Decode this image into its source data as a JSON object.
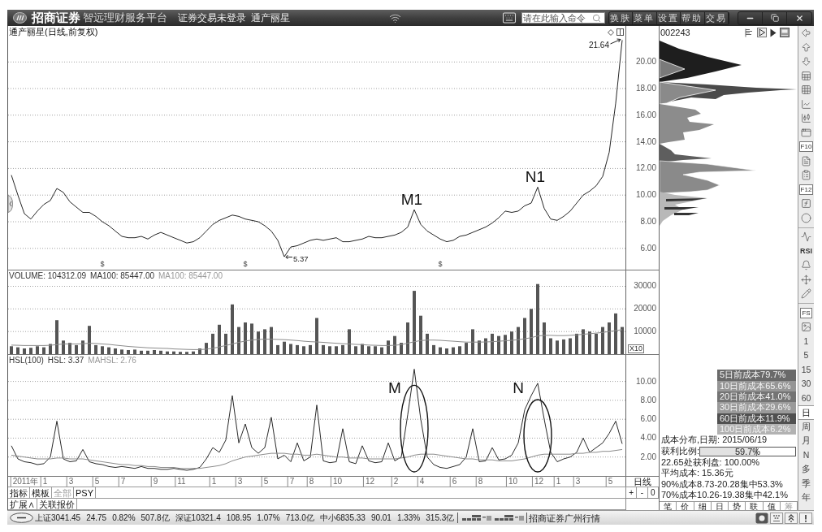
{
  "title_bar": {
    "brand": "招商证券",
    "platform": "智远理财服务平台",
    "login_status": "证券交易未登录",
    "stock_name": "通产丽星",
    "command_placeholder": "请在此输入命令",
    "menu": [
      "换肤",
      "菜单",
      "设置",
      "帮助",
      "交易"
    ]
  },
  "price_panel": {
    "chart_data": {
      "type": "line",
      "title": "通产丽星(日线,前复权)",
      "grid": true,
      "ylim": [
        4.4,
        22.7
      ],
      "yticks": [
        {
          "value": 6,
          "label": "6.00"
        },
        {
          "value": 8,
          "label": "8.00"
        },
        {
          "value": 10,
          "label": "10.00"
        },
        {
          "value": 12,
          "label": "12.00"
        },
        {
          "value": 14,
          "label": "14.00"
        },
        {
          "value": 16,
          "label": "16.00"
        },
        {
          "value": 18,
          "label": "18.00"
        },
        {
          "value": 20,
          "label": "20.00"
        }
      ],
      "values": [
        11.5,
        10.0,
        8.6,
        8.2,
        8.8,
        9.3,
        9.6,
        10.5,
        10.2,
        9.5,
        9.1,
        8.7,
        8.7,
        8.4,
        8.0,
        7.7,
        7.3,
        6.9,
        6.8,
        6.8,
        6.9,
        6.7,
        7.0,
        7.2,
        7.0,
        6.8,
        6.6,
        6.4,
        6.5,
        6.8,
        7.3,
        7.8,
        8.1,
        8.3,
        8.5,
        8.4,
        8.2,
        8.1,
        8.0,
        7.7,
        7.3,
        6.6,
        5.37,
        6.1,
        6.2,
        6.4,
        6.6,
        6.7,
        6.6,
        6.7,
        6.8,
        6.5,
        6.5,
        6.6,
        6.7,
        6.9,
        6.8,
        6.8,
        6.9,
        7.0,
        7.2,
        7.6,
        8.9,
        7.8,
        7.3,
        7.0,
        6.7,
        6.5,
        6.6,
        6.9,
        7.0,
        7.2,
        7.4,
        7.6,
        7.9,
        8.3,
        8.8,
        8.7,
        8.8,
        9.2,
        9.4,
        10.6,
        9.0,
        8.2,
        8.1,
        8.4,
        8.8,
        9.4,
        10.0,
        10.3,
        10.7,
        11.4,
        13.2,
        16.9,
        21.64
      ],
      "annotations": [
        "21.64",
        "M1",
        "N1",
        "5.37",
        "$",
        "$",
        "$"
      ]
    }
  },
  "volume_panel": {
    "legend": [
      {
        "text": "VOLUME: 104312.09",
        "color": "#333333"
      },
      {
        "text": "MA100: 85447.00",
        "color": "#333333"
      },
      {
        "text": "MA100: 85447.00",
        "color": "#999999"
      }
    ],
    "scale_label": "X10",
    "chart_data": {
      "type": "bar",
      "grid": true,
      "ylim": [
        0,
        37000
      ],
      "yticks": [
        10000,
        20000,
        30000
      ],
      "series": [
        {
          "color": "#555555",
          "values": [
            3500,
            3000,
            2500,
            2800,
            3500,
            3000,
            4500,
            15000,
            6000,
            5000,
            4000,
            6000,
            12500,
            4000,
            3500,
            3000,
            2500,
            2000,
            1800,
            2000,
            1500,
            1500,
            1800,
            1500,
            1200,
            1200,
            1000,
            1000,
            1200,
            2500,
            5000,
            9000,
            13000,
            9000,
            22000,
            12000,
            14000,
            13500,
            10000,
            11000,
            12000,
            4000,
            5500,
            4500,
            4000,
            3500,
            4000,
            16000,
            4000,
            3500,
            3500,
            4000,
            11000,
            3500,
            4500,
            3500,
            3500,
            3000,
            6000,
            8000,
            5000,
            14000,
            28000,
            17000,
            9000,
            4000,
            3000,
            2500,
            3000,
            3500,
            5000,
            11000,
            6000,
            7000,
            9000,
            8000,
            8500,
            10000,
            12000,
            16000,
            20000,
            31000,
            14000,
            7000,
            6000,
            6500,
            7000,
            9000,
            11000,
            10000,
            9000,
            12000,
            14000,
            18000,
            12000
          ]
        },
        {
          "type": "line",
          "color": "#8c8c8c",
          "values": [
            4000,
            3900,
            3800,
            3800,
            3800,
            3800,
            3900,
            4200,
            4500,
            4500,
            4500,
            4600,
            4800,
            4700,
            4500,
            4300,
            4000,
            3700,
            3400,
            3200,
            3000,
            2800,
            2700,
            2600,
            2500,
            2300,
            2200,
            2100,
            2000,
            2000,
            2200,
            2600,
            3200,
            3800,
            4500,
            5200,
            5800,
            6200,
            6500,
            6600,
            6600,
            6500,
            6400,
            6200,
            6000,
            5700,
            5500,
            5400,
            5200,
            5000,
            4800,
            4600,
            4500,
            4300,
            4200,
            4000,
            3900,
            3800,
            3800,
            3900,
            4200,
            4800,
            5500,
            6000,
            6200,
            6200,
            6100,
            5900,
            5700,
            5500,
            5300,
            5300,
            5300,
            5400,
            5500,
            5700,
            5900,
            6100,
            6400,
            6800,
            7300,
            8000,
            8300,
            8300,
            8200,
            8200,
            8300,
            8500,
            8800,
            9000,
            9300,
            9600,
            10000,
            10400,
            10800
          ]
        }
      ]
    }
  },
  "hsl_panel": {
    "legend": [
      {
        "text": "HSL(100)",
        "color": "#333333"
      },
      {
        "text": "HSL: 3.37",
        "color": "#333333"
      },
      {
        "text": "MAHSL: 2.76",
        "color": "#999999"
      }
    ],
    "chart_data": {
      "type": "line",
      "grid": true,
      "ylim": [
        0,
        12.8
      ],
      "categories": [
        null,
        null,
        "2011年",
        null,
        null,
        "1",
        null,
        null,
        null,
        "3",
        null,
        null,
        null,
        "5",
        null,
        null,
        null,
        "7",
        null,
        null,
        null,
        null,
        "9",
        null,
        null,
        null,
        "11",
        null,
        null,
        null,
        null,
        "1",
        null,
        null,
        null,
        "3",
        null,
        null,
        null,
        "5",
        null,
        null,
        null,
        "7",
        null,
        null,
        "8",
        null,
        null,
        null,
        "10",
        null,
        null,
        null,
        null,
        "12",
        null,
        null,
        null,
        "2",
        null,
        null,
        null,
        "4",
        null,
        null,
        null,
        null,
        "6",
        null,
        null,
        null,
        "8",
        null,
        null,
        null,
        null,
        "10",
        null,
        null,
        null,
        "12",
        null,
        null,
        "1",
        null,
        null,
        "3",
        null,
        null,
        null,
        null,
        "5",
        null,
        null
      ],
      "yticks": [
        {
          "value": 2,
          "label": "2.00"
        },
        {
          "value": 4,
          "label": "4.00"
        },
        {
          "value": 6,
          "label": "6.00"
        },
        {
          "value": 8,
          "label": "8.00"
        },
        {
          "value": 10,
          "label": "10.00"
        }
      ],
      "series": [
        {
          "color": "#2a2a2a",
          "values": [
            3.2,
            1.8,
            1.5,
            1.4,
            1.2,
            1.3,
            2.0,
            5.8,
            1.8,
            1.5,
            1.6,
            2.8,
            1.5,
            1.3,
            1.2,
            1.0,
            0.9,
            1.0,
            0.9,
            0.8,
            1.0,
            0.8,
            0.8,
            0.7,
            0.7,
            0.8,
            0.7,
            0.6,
            0.7,
            0.9,
            1.8,
            3.0,
            2.5,
            3.8,
            8.5,
            3.5,
            5.5,
            3.0,
            2.4,
            3.0,
            6.2,
            1.8,
            2.2,
            1.5,
            3.5,
            1.6,
            2.0,
            7.5,
            1.6,
            1.4,
            1.5,
            5.0,
            1.5,
            1.3,
            3.2,
            1.6,
            1.4,
            1.5,
            3.5,
            1.6,
            2.0,
            6.5,
            11.3,
            6.0,
            2.0,
            1.2,
            0.9,
            0.8,
            1.0,
            1.2,
            2.0,
            5.0,
            1.5,
            1.6,
            3.0,
            1.7,
            1.8,
            2.2,
            3.5,
            7.0,
            8.5,
            9.8,
            6.0,
            2.5,
            1.5,
            1.8,
            2.0,
            2.5,
            4.0,
            2.5,
            3.0,
            3.5,
            4.5,
            5.8,
            3.4
          ]
        },
        {
          "color": "#8c8c8c",
          "values": [
            2.2,
            2.1,
            2.0,
            1.9,
            1.8,
            1.8,
            1.8,
            1.9,
            1.9,
            1.8,
            1.8,
            1.8,
            1.7,
            1.6,
            1.5,
            1.4,
            1.3,
            1.2,
            1.2,
            1.1,
            1.1,
            1.0,
            1.0,
            0.9,
            0.9,
            0.9,
            0.8,
            0.8,
            0.8,
            0.8,
            0.9,
            1.0,
            1.1,
            1.3,
            1.6,
            1.8,
            2.0,
            2.1,
            2.2,
            2.3,
            2.4,
            2.4,
            2.4,
            2.3,
            2.3,
            2.2,
            2.2,
            2.3,
            2.2,
            2.1,
            2.0,
            2.0,
            1.9,
            1.9,
            1.9,
            1.8,
            1.8,
            1.8,
            1.8,
            1.8,
            1.9,
            2.0,
            2.2,
            2.3,
            2.3,
            2.3,
            2.2,
            2.1,
            2.0,
            1.9,
            1.8,
            1.8,
            1.7,
            1.7,
            1.7,
            1.6,
            1.6,
            1.6,
            1.7,
            1.8,
            2.0,
            2.2,
            2.3,
            2.3,
            2.3,
            2.3,
            2.3,
            2.4,
            2.4,
            2.5,
            2.5,
            2.6,
            2.6,
            2.7,
            2.8
          ]
        }
      ],
      "annotations": [
        "M",
        "N"
      ]
    }
  },
  "period_label": "日线",
  "zoom_buttons": [
    "+",
    "-",
    "0"
  ],
  "indicator_tabs": [
    {
      "label": "指标",
      "disabled": false
    },
    {
      "label": "模板",
      "disabled": false
    },
    {
      "label": "全部",
      "disabled": true
    },
    {
      "label": "PSY",
      "disabled": false
    }
  ],
  "extension_tabs": [
    "扩展∧",
    "关联报价"
  ],
  "chip_panel": {
    "code": "002243",
    "legend": [
      {
        "label": "5日前成本79.7%",
        "color": "#6a6a6a"
      },
      {
        "label": "10日前成本65.6%",
        "color": "#969696"
      },
      {
        "label": "20日前成本41.0%",
        "color": "#747474"
      },
      {
        "label": "30日前成本29.6%",
        "color": "#9a9a9a"
      },
      {
        "label": "60日前成本11.9%",
        "color": "#505050"
      },
      {
        "label": "100日前成本6.2%",
        "color": "#b2b2b2"
      }
    ],
    "date_line": "成本分布,日期: 2015/06/19",
    "profit_ratio": {
      "label": "获利比例:",
      "value": "59.7%",
      "level": 0.597
    },
    "lines": [
      "22.65处获利盘: 100.00%",
      "平均成本: 15.36元",
      "90%成本8.73-20.28集中53.3%",
      "70%成本10.26-19.38集中42.1%"
    ],
    "tabs": [
      {
        "label": "笔",
        "selected": false
      },
      {
        "label": "价",
        "selected": false
      },
      {
        "label": "细",
        "selected": false
      },
      {
        "label": "日",
        "selected": false
      },
      {
        "label": "势",
        "selected": false
      },
      {
        "label": "联",
        "selected": false
      },
      {
        "label": "值",
        "selected": false
      },
      {
        "label": "筹",
        "selected": true
      }
    ]
  },
  "toolbar": {
    "labels": [
      "F10",
      "F12",
      "RSI",
      "FS"
    ],
    "periods": [
      {
        "label": "1",
        "selected": false
      },
      {
        "label": "5",
        "selected": false
      },
      {
        "label": "15",
        "selected": false
      },
      {
        "label": "30",
        "selected": false
      },
      {
        "label": "60",
        "selected": false
      },
      {
        "label": "日",
        "selected": true
      },
      {
        "label": "周",
        "selected": false
      },
      {
        "label": "月",
        "selected": false
      },
      {
        "label": "N",
        "selected": false
      },
      {
        "label": "多",
        "selected": false
      },
      {
        "label": "季",
        "selected": false
      },
      {
        "label": "年",
        "selected": false
      }
    ]
  },
  "status_bar": {
    "indices": [
      {
        "name": "上证",
        "value": "3041.45",
        "change": "24.75",
        "percent": "0.82%",
        "amount": "507.8亿"
      },
      {
        "name": "深证",
        "value": "10321.4",
        "change": "108.95",
        "percent": "1.07%",
        "amount": "713.0亿"
      },
      {
        "name": "中小",
        "value": "6835.33",
        "change": "90.01",
        "percent": "1.33%",
        "amount": "315.3亿"
      }
    ],
    "source": "招商证券广州行情"
  }
}
